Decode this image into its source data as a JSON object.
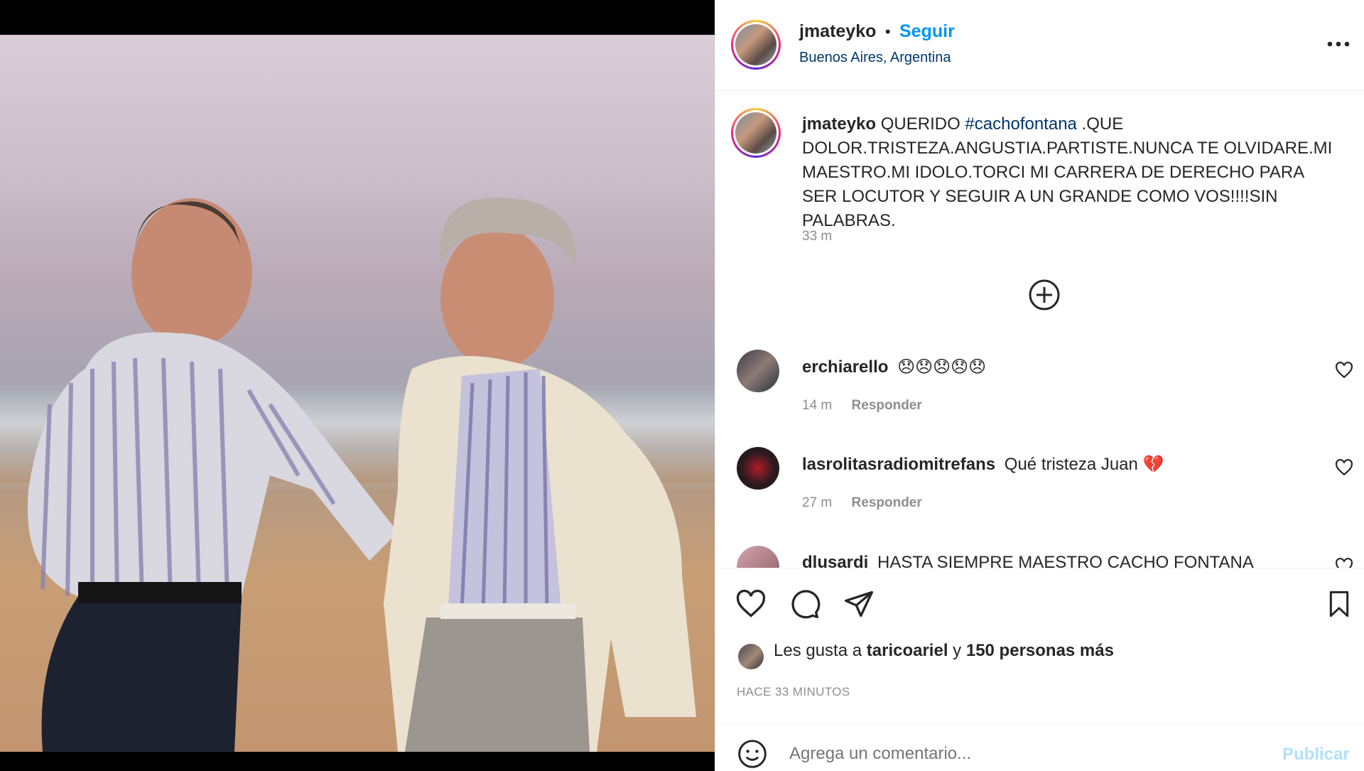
{
  "post": {
    "username": "jmateyko",
    "separator": "•",
    "follow_label": "Seguir",
    "location": "Buenos Aires, Argentina",
    "more_icon": "more-horizontal-icon"
  },
  "caption": {
    "username": "jmateyko",
    "text_before": "QUERIDO",
    "hashtag": "#cachofontana",
    "text_after": ".QUE DOLOR.TRISTEZA.ANGUSTIA.PARTISTE.NUNCA TE OLVIDARE.MI MAESTRO.MI IDOLO.TORCI MI CARRERA DE DERECHO PARA SER LOCUTOR Y SEGUIR A UN GRANDE COMO VOS!!!!SIN PALABRAS.",
    "time": "33 m"
  },
  "load_more_icon": "plus-circle-icon",
  "comments": [
    {
      "username": "erchiarello",
      "text": "😞😞😞😞😞",
      "time": "14 m",
      "reply": "Responder"
    },
    {
      "username": "lasrolitasradiomitrefans",
      "text": "Qué tristeza Juan 💔",
      "time": "27 m",
      "reply": "Responder"
    },
    {
      "username": "dlusardi",
      "text": "HASTA SIEMPRE MAESTRO CACHO FONTANA",
      "time": "",
      "reply": ""
    }
  ],
  "actions": {
    "like_icon": "heart-icon",
    "comment_icon": "comment-icon",
    "share_icon": "send-icon",
    "save_icon": "bookmark-icon"
  },
  "likes": {
    "prefix": "Les gusta a",
    "user": "taricoariel",
    "conj": "y",
    "others": "150 personas más"
  },
  "timestamp": "HACE 33 MINUTOS",
  "composer": {
    "emoji_icon": "smiley-icon",
    "placeholder": "Agrega un comentario...",
    "publish_label": "Publicar"
  },
  "colors": {
    "accent": "#0095f6",
    "link": "#00376b",
    "muted": "#8e8e8e",
    "text": "#262626",
    "publish_disabled": "#b2dffc"
  }
}
